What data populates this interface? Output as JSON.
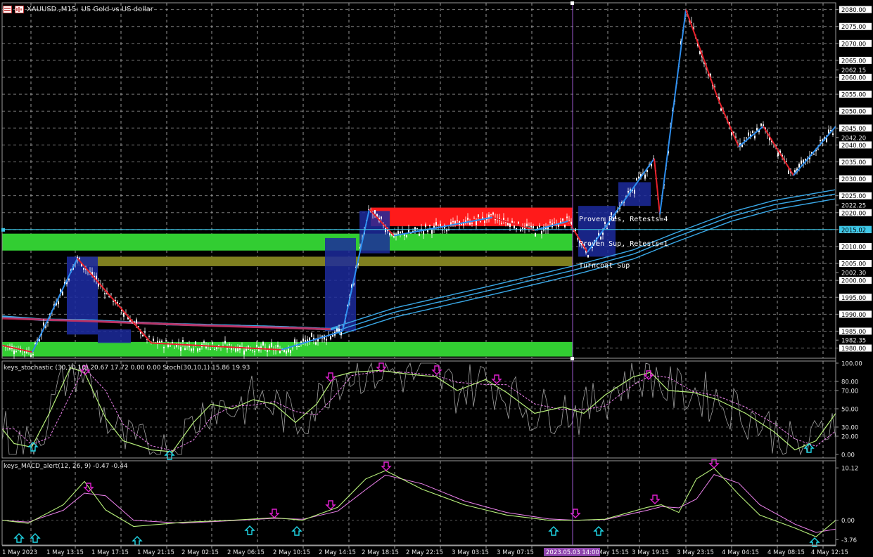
{
  "header": {
    "symbol": "XAUUSD.,M15:",
    "description": "US Gold vs US dollar"
  },
  "price_axis": {
    "labels": [
      "2080.00",
      "2075.00",
      "2070.00",
      "2065.00",
      "2062.15",
      "2060.00",
      "2055.00",
      "2050.00",
      "2045.00",
      "2042.20",
      "2040.00",
      "2035.00",
      "2030.00",
      "2025.00",
      "2022.25",
      "2020.00",
      "2015.00",
      "2010.00",
      "2005.00",
      "2002.30",
      "2000.00",
      "1995.00",
      "1990.00",
      "1985.00",
      "1982.35",
      "1980.00"
    ],
    "current_price": "2015.02"
  },
  "zone_labels": {
    "proven_res": "Proven Res, Retests=4",
    "proven_sup": "Proven Sup, Retests=1",
    "turncoat_sup": "Turncoat Sup"
  },
  "stochastic": {
    "label": "keys_stochastic (30,10,10) 20.67 17.72 0.00 0.00 Stoch(30,10,1) 15.86 19.93",
    "levels": [
      "100.00",
      "80.00",
      "70.00",
      "50.00",
      "30.00",
      "20.00",
      "0.00"
    ]
  },
  "macd": {
    "label": "keys_MACD_alert(12, 26, 9) -0.47 -0.44",
    "levels": [
      "10.12",
      "0.00",
      "-3.76"
    ]
  },
  "time_axis": {
    "labels": [
      "1 May 2023",
      "1 May 13:15",
      "1 May 17:15",
      "1 May 21:15",
      "2 May 02:15",
      "2 May 06:15",
      "2 May 10:15",
      "2 May 14:15",
      "2 May 18:15",
      "2 May 22:15",
      "3 May 03:15",
      "3 May 07:15",
      "3 May 15:15",
      "3 May 19:15",
      "3 May 23:15",
      "4 May 04:15",
      "4 May 08:15",
      "4 May 12:15"
    ],
    "crosshair_time": "2023.05.03 14:00"
  },
  "colors": {
    "background": "#000000",
    "grid": "#c8c8c8",
    "candle": "#ffffff",
    "zigzag_up": "#2e8ff0",
    "zigzag_down": "#e8202a",
    "ma": "#3aa9e8",
    "resistance_zone": "#ff1a1a",
    "support_zone": "#32cd32",
    "turncoat_zone": "#808020",
    "box": "#1c2a9c",
    "crosshair": "#9b59d0",
    "stoch_main": "#b7f07a",
    "stoch_signal": "#ee82ee",
    "stoch_raw": "#a0a0a0",
    "arrow_up": "#20d8e8",
    "arrow_down": "#e020d0"
  }
}
